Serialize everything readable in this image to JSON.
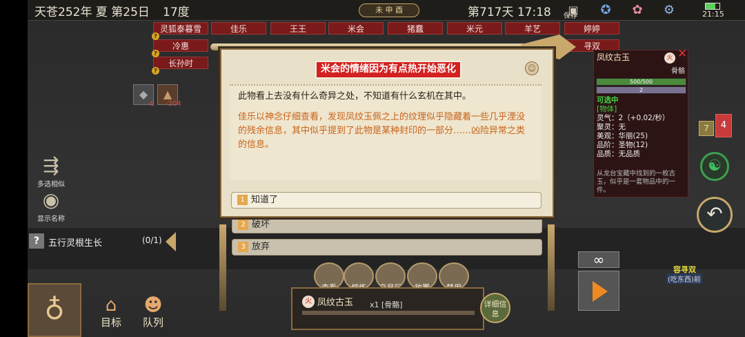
{
  "topbar": {
    "date": "天苍252年 夏 第25日",
    "temp": "17度",
    "calendar_label": "未 申 酉",
    "day_time": "第717天 17:18",
    "save_label": "保存",
    "clock": "21:15"
  },
  "name_tags": [
    "灵狐泰暮雪",
    "佳乐",
    "王王",
    "米会",
    "猪蠢",
    "米元",
    "羊艺",
    "婷婷",
    "冷惠",
    "寻双",
    "长孙时"
  ],
  "left_menu": {
    "select_similar": "多选相似",
    "show_names": "显示名称"
  },
  "resource_changes": [
    "-8",
    "-204"
  ],
  "quest": {
    "label": "五行灵根生长",
    "progress": "(0/1)"
  },
  "bottom_nav": {
    "goal": "目标",
    "queue": "队列"
  },
  "dialog": {
    "title": "米会的情绪因为有点热开始恶化",
    "text1": "此物看上去没有什么奇异之处，不知道有什么玄机在其中。",
    "text2": "佳乐以神念仔细查看，发现凤纹玉佩之上的纹理似乎隐藏着一些几乎湮没的残余信息，其中似乎提到了此物是某种封印的一部分……凶险异常之类的信息。",
    "options": [
      {
        "num": "1",
        "label": "知道了"
      },
      {
        "num": "2",
        "label": "破坏"
      },
      {
        "num": "3",
        "label": "放弃"
      }
    ]
  },
  "item_panel": {
    "name": "凤纹古玉",
    "element": "火",
    "type": "骨骼",
    "durability": "500/500",
    "count": "2",
    "status": "可选中",
    "category": "[物体]",
    "lines": [
      "灵气：2（+0.02/秒）",
      "聚灵：无",
      "美观：华丽(25)",
      "品阶：圣物(12)",
      "品质：无品质"
    ],
    "desc": "从龙台宝藏中找到的一枚古玉，似乎是一套物品中的一件。"
  },
  "notifications": {
    "yellow": "7",
    "red": "4"
  },
  "action_buttons": [
    "查看",
    "熔炼",
    "交易区",
    "放置",
    "禁用"
  ],
  "selected_item": {
    "element": "火",
    "name": "凤纹古玉",
    "qty": "x1 [骨骼]",
    "detail": "详细信息"
  },
  "right_bottom": {
    "infinity": "∞",
    "person_name": "容寻双",
    "person_status": "(吃东西)前"
  },
  "colors": {
    "title_red": "#d32020",
    "text_orange": "#c8631a",
    "green_status": "#43d643"
  }
}
